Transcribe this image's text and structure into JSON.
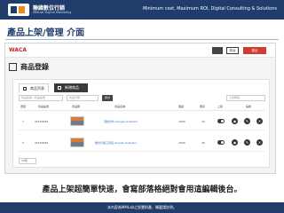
{
  "banner": {
    "logo_name": "聯緯數位行銷",
    "logo_sub": "MMLab Digital Marketing",
    "slogan": "Minimum cost, Maximum ROI, Digital Consulting & Solutions"
  },
  "page": {
    "title": "產品上架/管理 介面"
  },
  "app": {
    "brand": "WACA",
    "header_light_btn": "前台",
    "header_red_btn": "登出",
    "section_title": "商品登錄",
    "tabs": [
      {
        "label": "商品列表"
      },
      {
        "label": "新增商品"
      }
    ],
    "filters": {
      "keyword_placeholder": "商品名稱 / 商品編號",
      "category_placeholder": "商品分類",
      "search_label": "搜尋",
      "sort_value": "上架時間"
    },
    "table": {
      "columns": [
        "選取",
        "商品編號",
        "商品圖",
        "商品名稱",
        "價錢",
        "庫存",
        "上架",
        "編輯"
      ],
      "rows": [
        {
          "index": "1",
          "id": "20150930",
          "name": "測試文件 Google Analytics",
          "price": "3000",
          "stock": "10"
        },
        {
          "index": "2",
          "id": "20150930",
          "name": "數位行銷工具包 Google Analytics",
          "price": "2500",
          "stock": "20"
        }
      ]
    },
    "pager_value": "10筆"
  },
  "caption": {
    "text": "產品上架超簡單快速，會寫部落格絕對會用這編輯後台",
    "dot": "。"
  },
  "footer": {
    "text": "本內容為MMLab之智慧財產，轉載請註明。"
  },
  "colors": {
    "banner": "#1f3c6b",
    "accent_orange": "#f28a1a",
    "logout_red": "#d33a32",
    "link_blue": "#2d6fc5"
  }
}
